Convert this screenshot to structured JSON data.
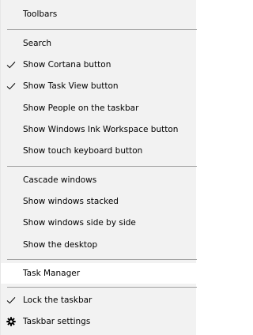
{
  "menu": {
    "items": [
      {
        "label": "Toolbars",
        "checked": false
      },
      {
        "label": "Search",
        "checked": false
      },
      {
        "label": "Show Cortana button",
        "checked": true
      },
      {
        "label": "Show Task View button",
        "checked": true
      },
      {
        "label": "Show People on the taskbar",
        "checked": false
      },
      {
        "label": "Show Windows Ink Workspace button",
        "checked": false
      },
      {
        "label": "Show touch keyboard button",
        "checked": false
      },
      {
        "label": "Cascade windows",
        "checked": false
      },
      {
        "label": "Show windows stacked",
        "checked": false
      },
      {
        "label": "Show windows side by side",
        "checked": false
      },
      {
        "label": "Show the desktop",
        "checked": false
      },
      {
        "label": "Task Manager",
        "checked": false,
        "highlighted": true
      },
      {
        "label": "Lock the taskbar",
        "checked": true
      },
      {
        "label": "Taskbar settings",
        "checked": false,
        "icon": "gear-icon"
      }
    ]
  }
}
